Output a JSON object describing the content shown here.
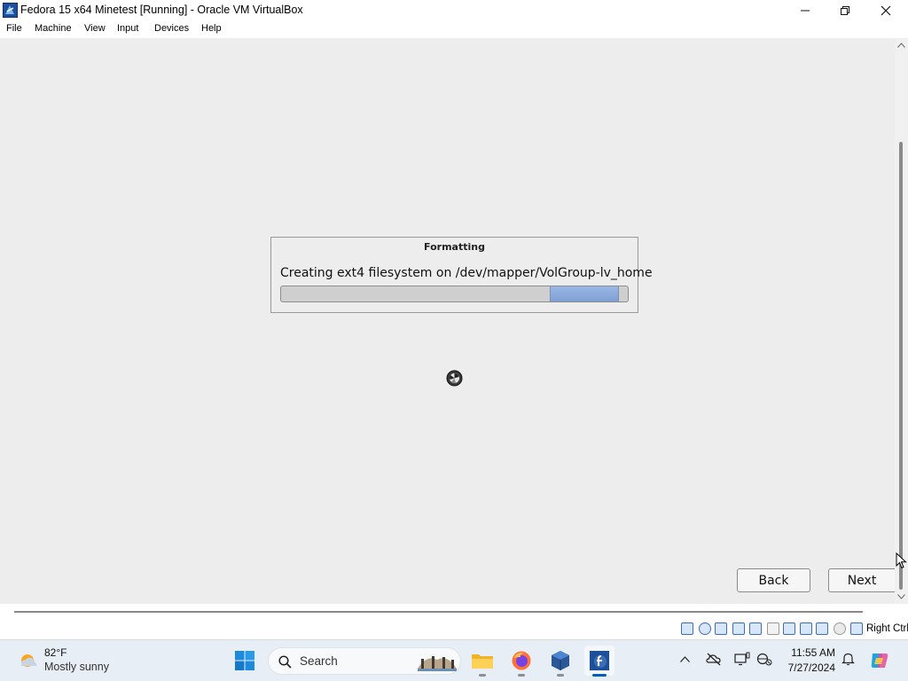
{
  "window": {
    "title": "Fedora 15 x64 Minetest [Running] - Oracle VM VirtualBox",
    "icon": "virtualbox-icon"
  },
  "menu": {
    "items": [
      "File",
      "Machine",
      "View",
      "Input",
      "Devices",
      "Help"
    ]
  },
  "installer": {
    "dialog_title": "Formatting",
    "message": "Creating ext4 filesystem on /dev/mapper/VolGroup-lv_home",
    "progress": {
      "type": "indeterminate",
      "highlight_start_fraction": 0.775,
      "highlight_end_fraction": 0.975
    },
    "back_label": "Back",
    "next_label": "Next"
  },
  "status_bar": {
    "host_key": "Right Ctrl",
    "icons": [
      "hard-disk-icon",
      "optical-drive-icon",
      "audio-icon",
      "network-icon",
      "usb-icon",
      "shared-folders-icon",
      "display-icon",
      "video-capture-icon",
      "virtualization-icon",
      "mouse-integration-icon",
      "keyboard-capture-icon"
    ]
  },
  "taskbar": {
    "weather": {
      "temp": "82°F",
      "desc": "Mostly sunny"
    },
    "search_placeholder": "Search",
    "apps": [
      "windows-start",
      "file-explorer",
      "firefox",
      "virtualbox-manager",
      "fedora-vm"
    ],
    "clock": {
      "time": "11:55 AM",
      "date": "7/27/2024"
    }
  }
}
